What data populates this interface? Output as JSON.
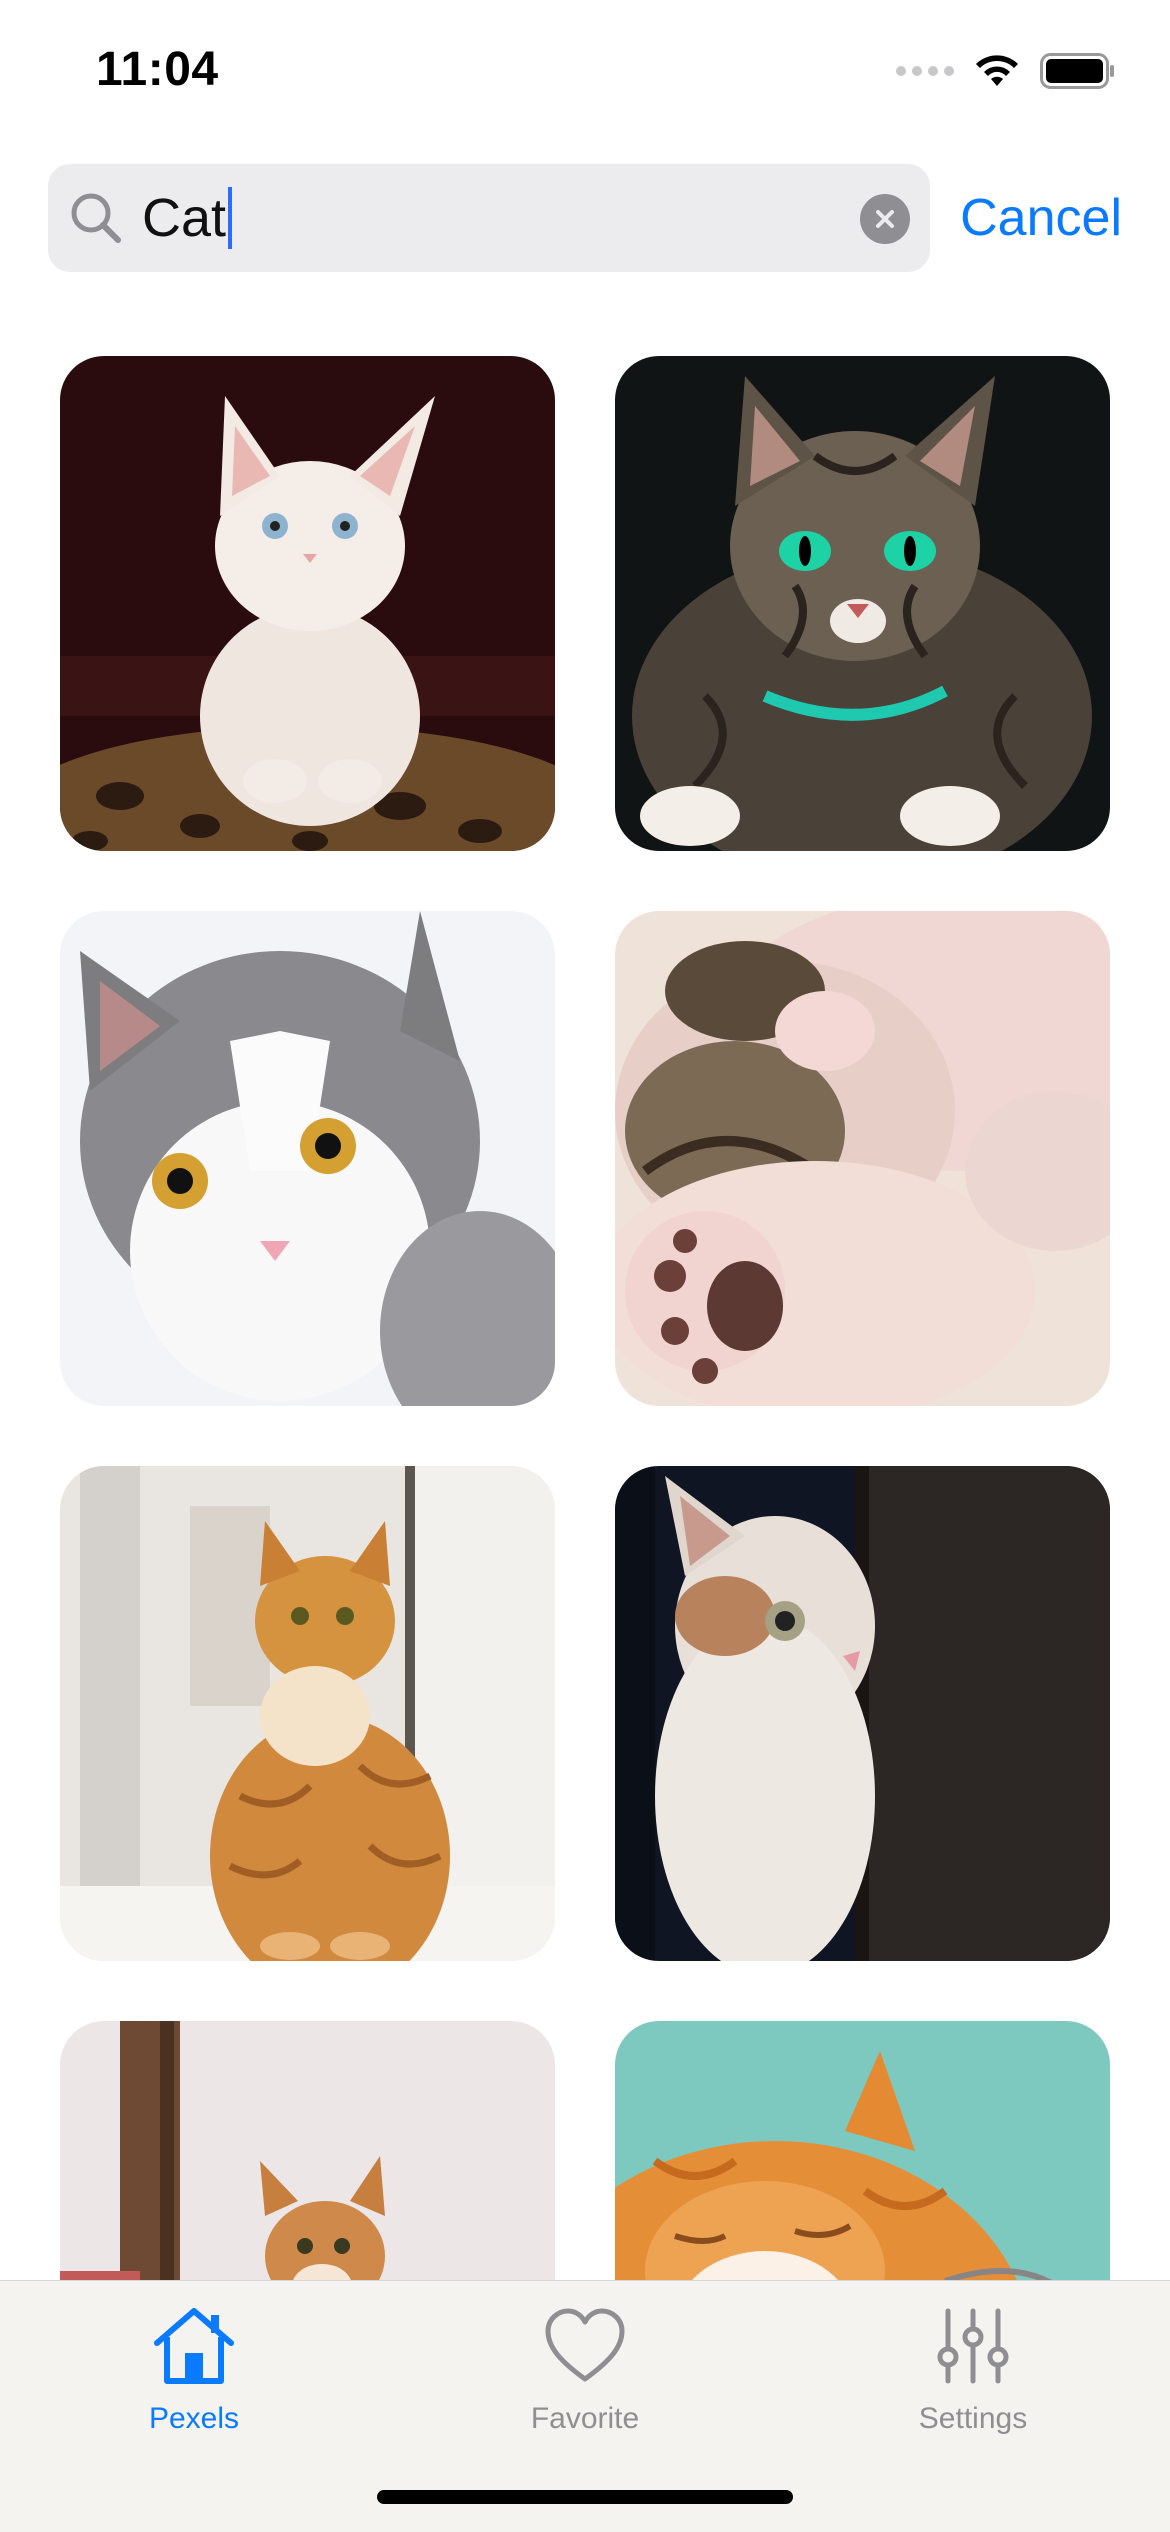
{
  "status_bar": {
    "time": "11:04"
  },
  "search": {
    "query": "Cat",
    "cancel_label": "Cancel"
  },
  "colors": {
    "accent": "#0a7aff",
    "inactive": "#8e8e93",
    "search_bg": "#ececee"
  },
  "grid": {
    "tiles": [
      {
        "subject": "white kitten with blue eyes"
      },
      {
        "subject": "tabby cat with green eyes"
      },
      {
        "subject": "grey and white cat"
      },
      {
        "subject": "sleeping kitten showing paw"
      },
      {
        "subject": "orange tabby cat sitting"
      },
      {
        "subject": "white kitten peeking behind door"
      },
      {
        "subject": "small ginger kitten"
      },
      {
        "subject": "orange cat sleeping"
      }
    ]
  },
  "tab_bar": {
    "tabs": [
      {
        "label": "Pexels",
        "icon": "house-icon",
        "active": true
      },
      {
        "label": "Favorite",
        "icon": "heart-icon",
        "active": false
      },
      {
        "label": "Settings",
        "icon": "sliders-icon",
        "active": false
      }
    ]
  }
}
